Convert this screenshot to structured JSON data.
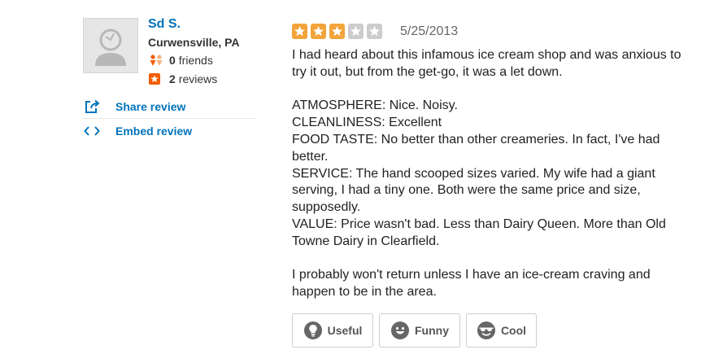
{
  "user": {
    "name": "Sd S.",
    "location": "Curwensville, PA",
    "friends_count": "0",
    "friends_label": "friends",
    "reviews_count": "2",
    "reviews_label": "reviews"
  },
  "actions": {
    "share_label": "Share review",
    "embed_label": "Embed review"
  },
  "review": {
    "rating": 3,
    "rating_max": 5,
    "star_on_color": "#f2a43a",
    "star_off_color": "#cccccc",
    "date": "5/25/2013",
    "paragraphs": [
      "I had heard about this infamous ice cream shop and was anxious to try it out, but from the get-go, it was a let down.",
      "",
      "ATMOSPHERE: Nice. Noisy.",
      "CLEANLINESS: Excellent",
      "FOOD TASTE: No better than other creameries. In fact, I've had better.",
      "SERVICE: The hand scooped sizes varied. My wife had a giant serving, I had a tiny one. Both were the same price and size, supposedly.",
      "VALUE: Price wasn't bad. Less than Dairy Queen. More than Old Towne Dairy in Clearfield.",
      "",
      "I probably won't return unless I have an ice-cream craving and happen to be in the area."
    ]
  },
  "votes": {
    "useful_label": "Useful",
    "funny_label": "Funny",
    "cool_label": "Cool"
  },
  "colors": {
    "link": "#0073bb",
    "text": "#222222"
  }
}
